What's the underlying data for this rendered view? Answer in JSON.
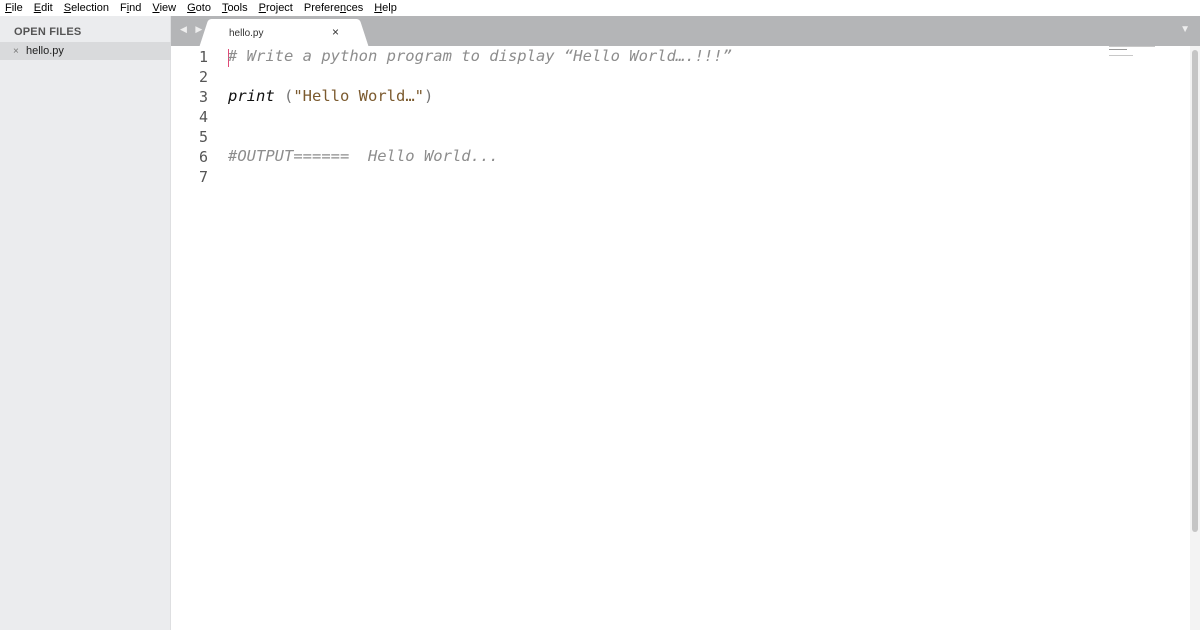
{
  "menu": {
    "items": [
      {
        "accel": "F",
        "rest": "ile"
      },
      {
        "accel": "E",
        "rest": "dit"
      },
      {
        "accel": "S",
        "rest": "election"
      },
      {
        "pre": "F",
        "accel": "i",
        "rest": "nd"
      },
      {
        "accel": "V",
        "rest": "iew"
      },
      {
        "accel": "G",
        "rest": "oto"
      },
      {
        "accel": "T",
        "rest": "ools"
      },
      {
        "accel": "P",
        "rest": "roject"
      },
      {
        "pre": "Prefere",
        "accel": "n",
        "rest": "ces"
      },
      {
        "accel": "H",
        "rest": "elp"
      }
    ]
  },
  "sidebar": {
    "title": "OPEN FILES",
    "files": [
      {
        "close": "×",
        "name": "hello.py"
      }
    ]
  },
  "tabs": {
    "nav": "◀ ▶",
    "active": {
      "label": "hello.py",
      "close": "×"
    },
    "dropdown": "▼"
  },
  "editor": {
    "line_numbers": [
      "1",
      "2",
      "3",
      "4",
      "5",
      "6",
      "7"
    ],
    "line1": "# Write a python program to display “Hello World….!!!”",
    "line3_kw": "print",
    "line3_open": " (",
    "line3_str": "\"Hello World…\"",
    "line3_close": ")",
    "line6": "#OUTPUT======  Hello World..."
  },
  "colors": {
    "sidebar_bg": "#ebecee",
    "tabbar_bg": "#b4b5b7",
    "comment": "#8d8d8d",
    "string": "#7b5a2e",
    "caret": "#e04a77"
  }
}
